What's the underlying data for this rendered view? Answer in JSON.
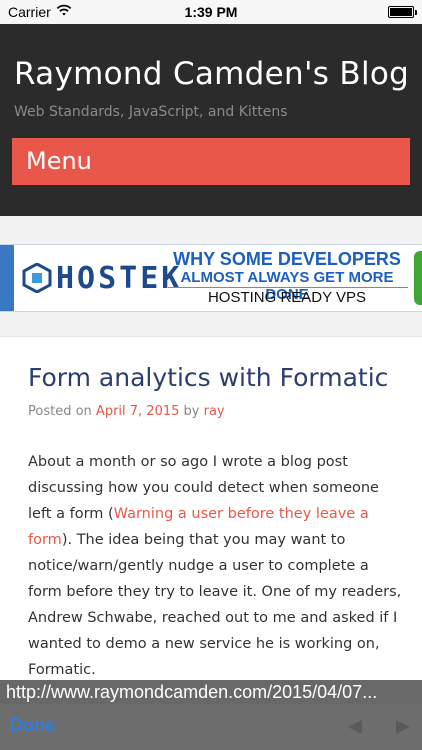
{
  "status_bar": {
    "carrier": "Carrier",
    "time": "1:39 PM"
  },
  "header": {
    "site_title": "Raymond Camden's Blog",
    "site_description": "Web Standards, JavaScript, and Kittens",
    "menu_label": "Menu"
  },
  "ad": {
    "brand": "HOSTEK",
    "headline_line1": "WHY SOME DEVELOPERS",
    "headline_line2": "ALMOST ALWAYS GET MORE DONE",
    "tagline": "HOSTING READY VPS"
  },
  "post": {
    "title": "Form analytics with Formatic",
    "meta_prefix": "Posted on",
    "date": "April 7, 2015",
    "meta_by": "by",
    "author": "ray",
    "paragraph_before_link": "About a month or so ago I wrote a blog post discussing how you could detect when someone left a form (",
    "link_text": "Warning a user before they leave a form",
    "paragraph_after_link": "). The idea being that you may want to notice/warn/gently nudge a user to complete a form before they try to leave it. One of my readers, Andrew Schwabe, reached out to me and asked if I wanted to demo a new service he is working on, Formatic."
  },
  "url_preview": "http://www.raymondcamden.com/2015/04/07...",
  "toolbar": {
    "done_label": "Done"
  },
  "colors": {
    "accent": "#e9574a",
    "header_bg": "#2b2b2b",
    "title_blue": "#2c3e6f",
    "ios_blue": "#2f7de1"
  }
}
